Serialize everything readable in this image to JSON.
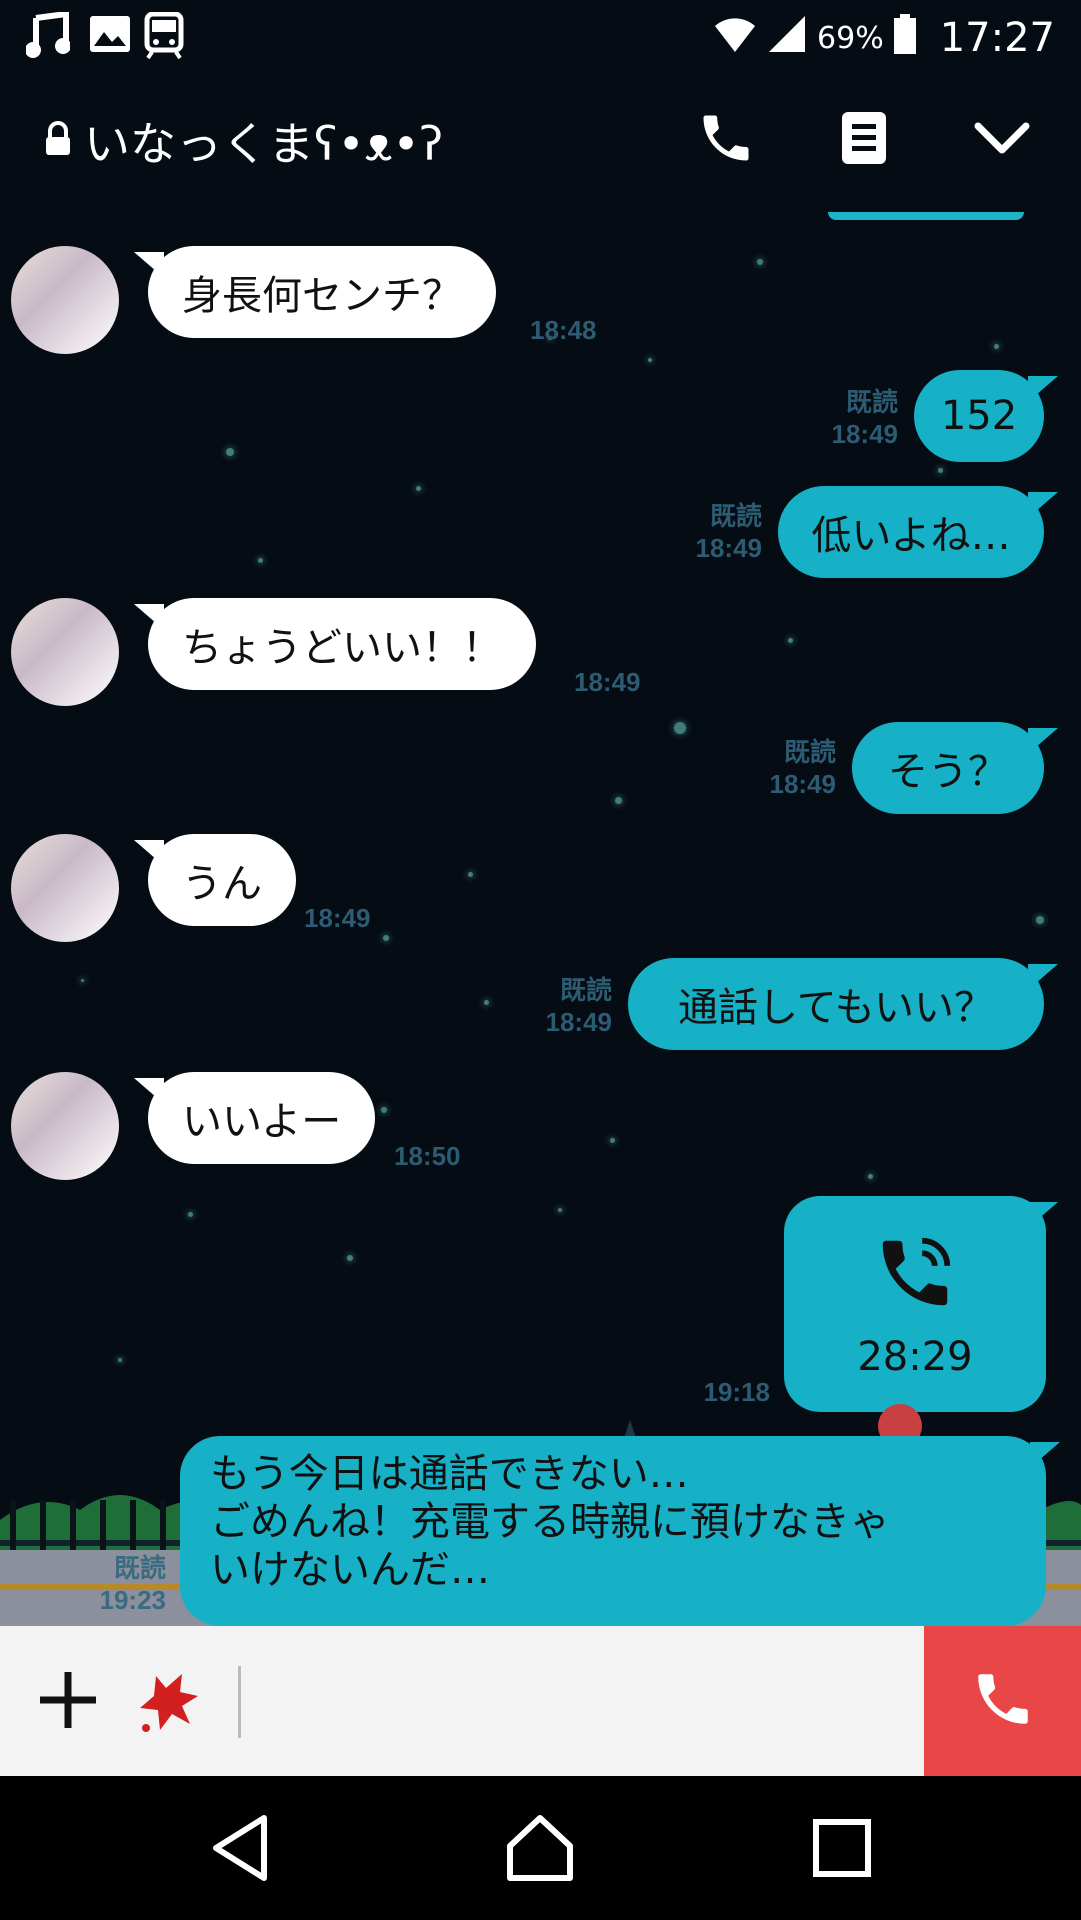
{
  "status_bar": {
    "left_icons": [
      "music-icon",
      "image-icon",
      "train-icon"
    ],
    "battery_percent": "69%",
    "time": "17:27"
  },
  "header": {
    "title": "いなっくまʕ•ᴥ•ʔ",
    "icons": [
      "lock-icon",
      "phone-icon",
      "notes-icon",
      "chevron-down-icon"
    ]
  },
  "messages": [
    {
      "side": "in",
      "text": "身長何センチ？",
      "time": "18:48"
    },
    {
      "side": "out",
      "text": "152",
      "read": "既読",
      "time": "18:49"
    },
    {
      "side": "out",
      "text": "低いよね…",
      "read": "既読",
      "time": "18:49"
    },
    {
      "side": "in",
      "text": "ちょうどいい！！",
      "time": "18:49"
    },
    {
      "side": "out",
      "text": "そう？",
      "read": "既読",
      "time": "18:49"
    },
    {
      "side": "in",
      "text": "うん",
      "time": "18:49"
    },
    {
      "side": "out",
      "text": "通話してもいい？",
      "read": "既読",
      "time": "18:49"
    },
    {
      "side": "in",
      "text": "いいよー",
      "time": "18:50"
    }
  ],
  "call_message": {
    "icon": "call-icon",
    "duration": "28:29",
    "time": "19:18"
  },
  "last_message": {
    "lines": [
      "もう今日は通話できない…",
      "ごめんね！充電する時親に預けなきゃ",
      "いけないんだ…"
    ],
    "read": "既読",
    "time": "19:23"
  },
  "input_bar": {
    "icons": [
      "plus-icon",
      "sticker-icon",
      "phone-end-icon"
    ],
    "colors": {
      "call_button": "#e94747"
    }
  },
  "nav_bar": {
    "icons": [
      "back-icon",
      "home-icon",
      "recents-icon"
    ]
  },
  "colors": {
    "background": "#050c14",
    "outgoing_bubble": "#17b1c7",
    "incoming_bubble": "#ffffff",
    "timestamp": "#2d5b72"
  }
}
